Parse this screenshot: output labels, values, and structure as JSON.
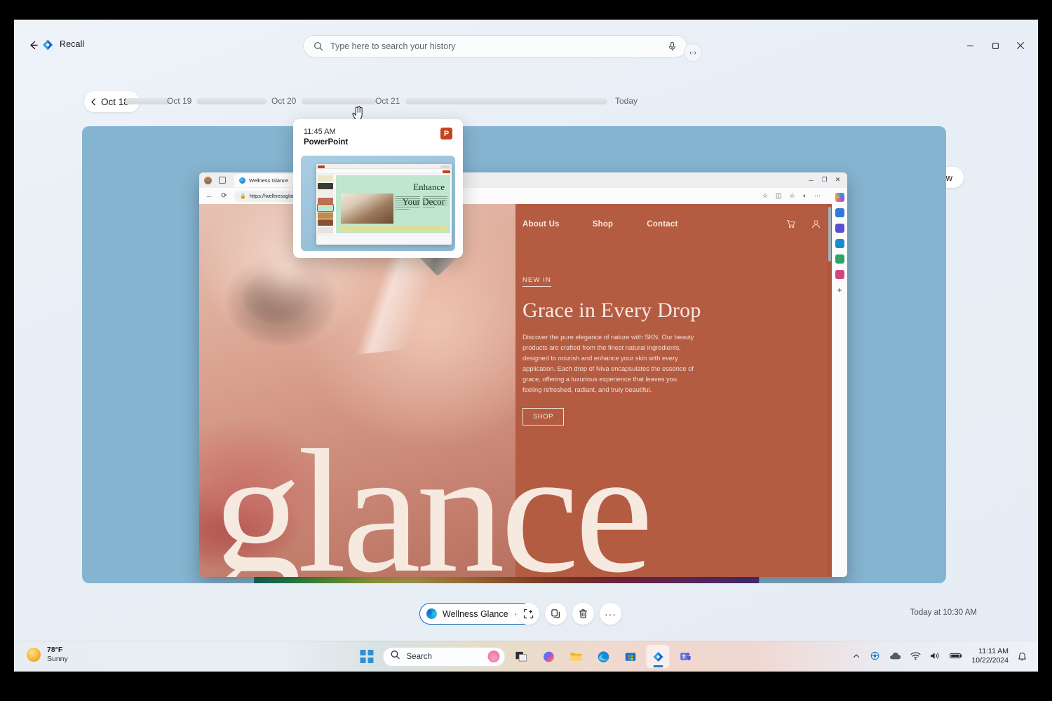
{
  "app": {
    "title": "Recall",
    "back_icon": "back-arrow-icon",
    "app_icon": "recall-icon"
  },
  "search": {
    "placeholder": "Type here to search your history",
    "search_icon": "search-icon",
    "mic_icon": "microphone-icon",
    "expand_icon": "‹·›"
  },
  "window_controls": {
    "minimize": "─",
    "maximize": "❐",
    "close": "✕"
  },
  "timeline": {
    "current_day": "Oct 18",
    "chevron": "‹",
    "labels": [
      "Oct 19",
      "Oct 20",
      "Oct 21",
      "Today"
    ],
    "now_label": "Now",
    "slider_value": 75
  },
  "hover_card": {
    "time": "11:45 AM",
    "app": "PowerPoint",
    "icon": "powerpoint-icon",
    "icon_letter": "P",
    "slide_title_line1": "Enhance",
    "slide_title_line2": "Your Decor"
  },
  "browser": {
    "tab_title": "Wellness Glance",
    "tab_close": "✕",
    "url": "https://wellnessglance.com",
    "lock_icon": "lock-icon",
    "back_icon": "←",
    "refresh_icon": "⟳",
    "toolbar_icons": [
      "favorites-icon",
      "split-screen-icon",
      "collections-icon",
      "browser-essentials-icon",
      "settings-more-icon"
    ],
    "window_controls": [
      "─",
      "❐",
      "✕"
    ],
    "sidebar_icons": [
      "copilot-icon",
      "shopping-icon",
      "office-icon",
      "outlook-icon",
      "tools-icon",
      "games-icon",
      "add-icon"
    ]
  },
  "website": {
    "nav": [
      "About Us",
      "Shop",
      "Contact"
    ],
    "cart_icon": "cart-icon",
    "account_icon": "account-icon",
    "eyebrow": "NEW IN",
    "title": "Grace in Every Drop",
    "body": "Discover the pure elegance of nature with SKN. Our beauty products are crafted from the finest natural ingredients, designed to nourish and enhance your skin with every application. Each drop of Niva encapsulates the essence of grace, offering a luxurious experience that leaves you feeling refreshed, radiant, and truly beautiful.",
    "cta": "SHOP",
    "watermark": "glance"
  },
  "actions": {
    "app_name": "Wellness Glance",
    "app_icon": "edge-icon",
    "app_menu_dots": "···",
    "clicktodo_icon": "click-to-do-icon",
    "copy_icon": "copy-icon",
    "delete_icon": "delete-icon",
    "more_icon": "···",
    "timestamp": "Today at 10:30 AM"
  },
  "taskbar": {
    "weather_temp": "78°F",
    "weather_cond": "Sunny",
    "weather_icon": "sun-icon",
    "start_icon": "start-icon",
    "search_placeholder": "Search",
    "search_icon": "search-icon",
    "lotus_icon": "lotus-icon",
    "apps": [
      "task-view-icon",
      "copilot-icon",
      "file-explorer-icon",
      "edge-icon",
      "microsoft-store-icon",
      "recall-icon",
      "teams-icon"
    ],
    "tray": {
      "chevron_icon": "show-hidden-icons-icon",
      "onedrive_icon": "onedrive-icon",
      "cloud_icon": "cloud-icon",
      "wifi_icon": "wifi-icon",
      "volume_icon": "volume-icon",
      "battery_icon": "battery-icon",
      "notification_icon": "notification-bell-icon",
      "time": "11:11 AM",
      "date": "10/22/2024"
    }
  },
  "colors": {
    "accent": "#0e66b8",
    "site_bg": "#b45c42",
    "snapshot_bg": "#85b4d0",
    "powerpoint": "#c5441f"
  }
}
